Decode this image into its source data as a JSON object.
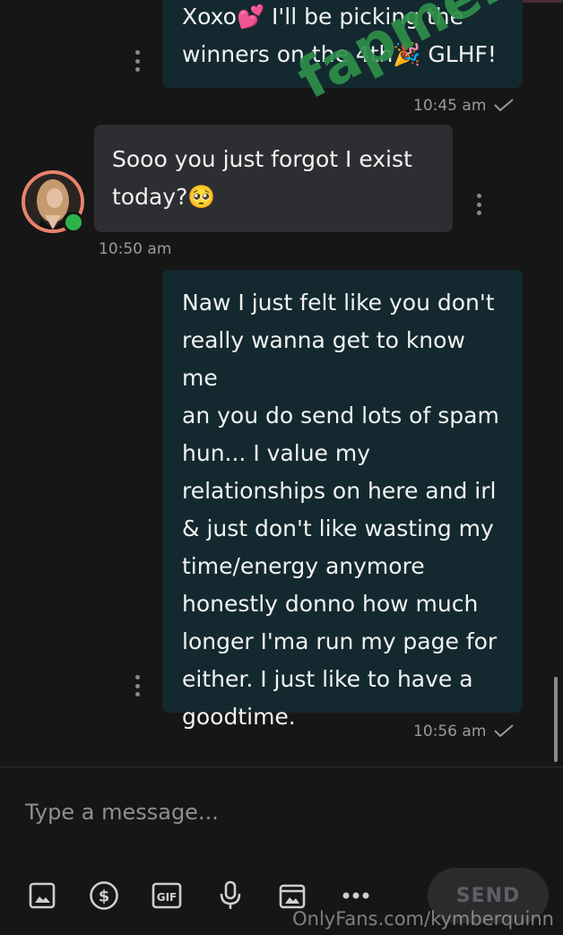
{
  "messages": [
    {
      "direction": "out",
      "lines": [
        "Xoxo💕 I'll be picking the",
        "winners on the 4th🎉 GLHF!"
      ],
      "time": "10:45 am"
    },
    {
      "direction": "in",
      "lines": [
        "Sooo you just forgot I exist",
        "today?🥺"
      ],
      "time": "10:50 am"
    },
    {
      "direction": "out",
      "lines": [
        "Naw I just felt like you don't",
        "really wanna get to know me",
        "an you do send lots of spam",
        "hun... I value my",
        "relationships on here and irl",
        "& just don't like wasting my",
        "time/energy anymore",
        "honestly donno how much",
        "longer I'ma run my page for",
        "either. I just like to have a",
        "goodtime."
      ],
      "time": "10:56 am"
    }
  ],
  "composer": {
    "placeholder": "Type a message...",
    "send_label": "SEND"
  },
  "toolbar_icons": [
    "image-icon",
    "dollar-icon",
    "gif-icon",
    "microphone-icon",
    "vault-icon",
    "more-icon"
  ],
  "watermark": "OnlyFans.com/kymberquinn",
  "brand_watermark": "fapmenu.com",
  "colors": {
    "background": "#161616",
    "outgoing_bubble": "#13292f",
    "incoming_bubble": "#2c2e31",
    "online": "#2bb44a",
    "brand_watermark": "#2f8f4a"
  }
}
